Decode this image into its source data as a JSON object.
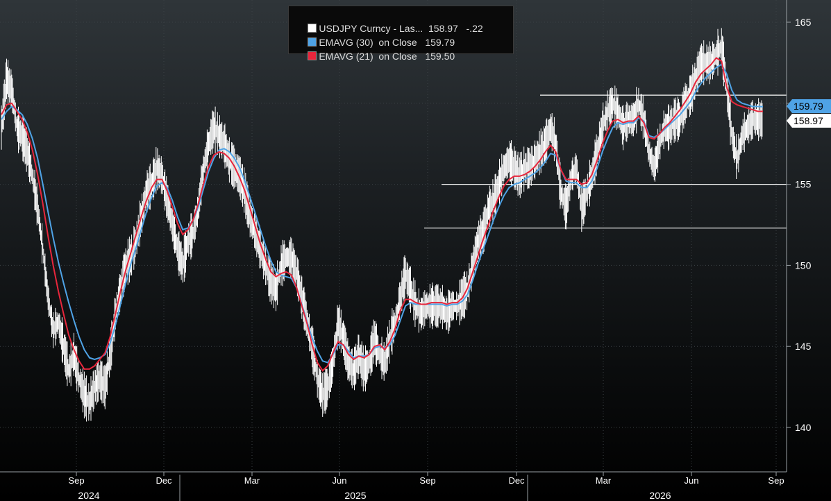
{
  "chart_data": {
    "type": "line",
    "title": "",
    "legend": [
      {
        "text": "USDJPY Curncy - Las...  158.97   -.22",
        "color": "#ffffff"
      },
      {
        "text": "EMAVG (30)  on Close   159.79",
        "color": "#4fa3e6"
      },
      {
        "text": "EMAVG (21)  on Close   159.50",
        "color": "#e8263c"
      }
    ],
    "last_tags": [
      {
        "text": "159.79",
        "color": "#4fa3e6"
      },
      {
        "text": "158.97",
        "color": "#ffffff"
      }
    ],
    "ylim": [
      137.5,
      166.5
    ],
    "yticks": [
      140,
      145,
      150,
      155,
      160,
      165
    ],
    "ytick_labels": [
      "140",
      "145",
      "150",
      "155",
      "",
      "165"
    ],
    "x_month_ticks": [
      "Sep",
      "Dec",
      "Mar",
      "Jun",
      "Sep",
      "Dec",
      "Mar",
      "Jun",
      "Sep"
    ],
    "x_year_labels": [
      "2024",
      "2025",
      "2026"
    ],
    "horizontal_levels": [
      160.5,
      155.0,
      152.3
    ],
    "series": [
      {
        "name": "USDJPY Curncy",
        "color": "#ffffff",
        "values": [
          158.5,
          161.5,
          160.8,
          158.5,
          158.0,
          157.0,
          155.5,
          153.5,
          151.0,
          148.0,
          146.0,
          146.5,
          145.0,
          143.5,
          144.5,
          143.0,
          142.0,
          141.5,
          142.5,
          143.0,
          142.5,
          144.5,
          147.0,
          148.5,
          150.0,
          150.5,
          151.5,
          153.0,
          154.5,
          155.0,
          156.0,
          155.5,
          154.0,
          152.5,
          151.0,
          150.0,
          151.5,
          152.0,
          153.5,
          156.0,
          157.5,
          158.5,
          158.0,
          157.5,
          156.5,
          156.0,
          155.5,
          154.5,
          153.0,
          152.0,
          151.0,
          150.0,
          149.0,
          148.5,
          150.0,
          150.5,
          150.5,
          149.5,
          148.0,
          146.5,
          145.0,
          143.0,
          142.0,
          142.5,
          144.0,
          146.5,
          145.5,
          144.0,
          143.5,
          144.5,
          143.5,
          144.0,
          145.5,
          144.5,
          144.0,
          145.5,
          146.5,
          148.0,
          149.5,
          148.5,
          147.5,
          147.0,
          147.5,
          147.5,
          147.5,
          147.5,
          147.0,
          147.5,
          147.5,
          148.0,
          148.5,
          150.0,
          151.5,
          152.0,
          153.5,
          154.0,
          155.0,
          156.0,
          156.5,
          156.0,
          155.5,
          156.0,
          156.0,
          156.5,
          157.0,
          157.5,
          158.5,
          157.5,
          154.5,
          153.5,
          155.5,
          156.0,
          153.5,
          154.5,
          155.5,
          157.0,
          158.5,
          159.5,
          160.0,
          159.5,
          158.5,
          159.0,
          159.0,
          160.0,
          159.0,
          157.0,
          156.0,
          157.5,
          158.5,
          158.5,
          159.0,
          159.0,
          160.0,
          160.5,
          161.5,
          162.5,
          162.5,
          162.5,
          163.0,
          163.5,
          161.0,
          158.0,
          156.5,
          158.0,
          158.5,
          159.0,
          159.0,
          158.97
        ]
      },
      {
        "name": "EMAVG (30) on Close",
        "color": "#4fa3e6",
        "values": [
          159.0,
          159.5,
          159.8,
          159.6,
          159.3,
          158.7,
          157.8,
          156.6,
          155.0,
          153.3,
          151.7,
          150.2,
          148.9,
          147.7,
          146.6,
          145.6,
          144.8,
          144.3,
          144.2,
          144.3,
          144.5,
          145.2,
          146.3,
          147.6,
          148.9,
          150.1,
          151.1,
          152.2,
          153.3,
          154.2,
          154.9,
          155.1,
          154.8,
          154.0,
          153.0,
          152.2,
          152.3,
          152.8,
          153.6,
          154.7,
          155.8,
          156.6,
          157.1,
          157.2,
          157.0,
          156.6,
          156.0,
          155.2,
          154.2,
          153.2,
          152.2,
          151.2,
          150.3,
          149.6,
          149.4,
          149.3,
          149.2,
          148.6,
          147.6,
          146.5,
          145.5,
          144.7,
          144.1,
          144.0,
          144.5,
          145.1,
          145.1,
          144.7,
          144.3,
          144.4,
          144.4,
          144.5,
          144.9,
          145.0,
          144.9,
          145.1,
          145.7,
          146.6,
          147.5,
          147.7,
          147.6,
          147.6,
          147.6,
          147.6,
          147.6,
          147.6,
          147.5,
          147.6,
          147.6,
          147.8,
          148.2,
          149.1,
          150.1,
          151.0,
          151.9,
          152.8,
          153.6,
          154.3,
          154.8,
          155.0,
          155.1,
          155.3,
          155.5,
          155.7,
          156.0,
          156.4,
          156.9,
          156.8,
          155.9,
          155.2,
          155.1,
          155.1,
          154.8,
          154.8,
          155.2,
          156.0,
          157.0,
          157.8,
          158.5,
          158.8,
          158.7,
          158.8,
          158.8,
          159.1,
          158.9,
          158.0,
          157.9,
          158.1,
          158.4,
          158.7,
          159.0,
          159.3,
          159.7,
          160.1,
          160.7,
          161.2,
          161.6,
          161.9,
          162.2,
          162.4,
          161.8,
          160.8,
          160.2,
          160.0,
          159.9,
          159.8,
          159.8,
          159.79
        ]
      },
      {
        "name": "EMAVG (21) on Close",
        "color": "#e8263c",
        "values": [
          159.3,
          159.9,
          160.0,
          159.5,
          159.0,
          158.2,
          157.1,
          155.6,
          153.8,
          151.8,
          150.0,
          148.4,
          147.0,
          145.7,
          144.8,
          144.1,
          143.6,
          143.6,
          143.8,
          144.2,
          144.6,
          145.6,
          147.0,
          148.4,
          149.7,
          150.8,
          151.9,
          153.0,
          154.0,
          154.8,
          155.3,
          155.3,
          154.6,
          153.6,
          152.6,
          151.9,
          152.2,
          152.8,
          153.8,
          155.0,
          156.1,
          156.8,
          157.0,
          156.9,
          156.6,
          156.1,
          155.4,
          154.6,
          153.5,
          152.4,
          151.3,
          150.4,
          149.6,
          149.3,
          149.5,
          149.6,
          149.4,
          148.6,
          147.5,
          146.4,
          145.1,
          144.0,
          143.5,
          143.8,
          144.6,
          145.3,
          145.1,
          144.5,
          144.2,
          144.4,
          144.3,
          144.5,
          145.0,
          145.1,
          144.8,
          145.3,
          146.1,
          147.2,
          147.9,
          147.9,
          147.7,
          147.6,
          147.6,
          147.7,
          147.7,
          147.7,
          147.6,
          147.7,
          147.7,
          148.0,
          148.6,
          149.6,
          150.6,
          151.6,
          152.5,
          153.4,
          154.2,
          154.9,
          155.3,
          155.5,
          155.5,
          155.6,
          155.8,
          156.1,
          156.5,
          157.0,
          157.4,
          157.0,
          155.9,
          155.3,
          155.3,
          155.3,
          155.0,
          155.1,
          155.6,
          156.5,
          157.5,
          158.3,
          158.9,
          159.0,
          158.8,
          158.9,
          158.9,
          159.2,
          158.8,
          157.9,
          157.8,
          158.1,
          158.5,
          158.8,
          159.2,
          159.6,
          160.1,
          160.6,
          161.3,
          161.8,
          162.1,
          162.4,
          162.8,
          162.6,
          161.0,
          160.1,
          159.9,
          159.8,
          159.7,
          159.6,
          159.5,
          159.5
        ]
      }
    ]
  }
}
